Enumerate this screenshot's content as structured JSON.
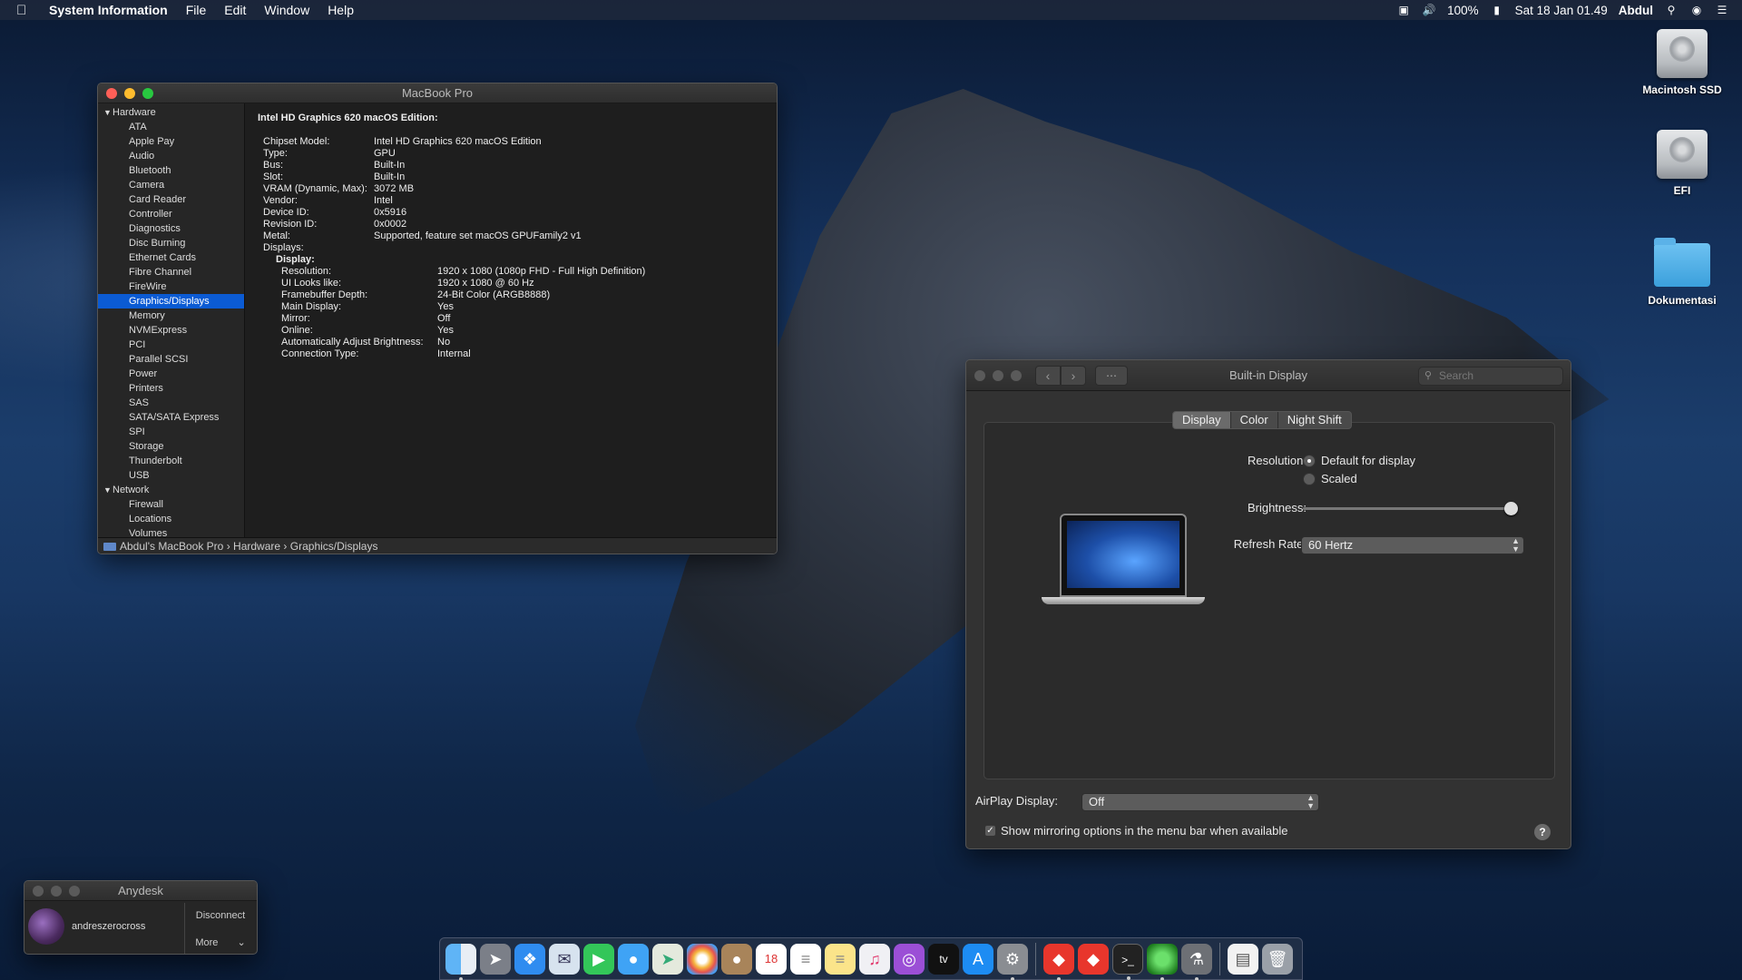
{
  "menubar": {
    "app": "System Information",
    "menus": [
      "File",
      "Edit",
      "Window",
      "Help"
    ],
    "battery": "100%",
    "datetime": "Sat 18 Jan  01.49",
    "user": "Abdul"
  },
  "desktop": {
    "icons": [
      "Macintosh SSD",
      "EFI",
      "Dokumentasi"
    ]
  },
  "sysinfo": {
    "title": "MacBook Pro",
    "sidebar": {
      "hardware_label": "Hardware",
      "hardware_items": [
        "ATA",
        "Apple Pay",
        "Audio",
        "Bluetooth",
        "Camera",
        "Card Reader",
        "Controller",
        "Diagnostics",
        "Disc Burning",
        "Ethernet Cards",
        "Fibre Channel",
        "FireWire",
        "Graphics/Displays",
        "Memory",
        "NVMExpress",
        "PCI",
        "Parallel SCSI",
        "Power",
        "Printers",
        "SAS",
        "SATA/SATA Express",
        "SPI",
        "Storage",
        "Thunderbolt",
        "USB"
      ],
      "selected": "Graphics/Displays",
      "network_label": "Network",
      "network_items": [
        "Firewall",
        "Locations",
        "Volumes"
      ]
    },
    "main": {
      "heading": "Intel HD Graphics 620 macOS Edition:",
      "rows": [
        {
          "k": "Chipset Model:",
          "v": "Intel HD Graphics 620 macOS Edition"
        },
        {
          "k": "Type:",
          "v": "GPU"
        },
        {
          "k": "Bus:",
          "v": "Built-In"
        },
        {
          "k": "Slot:",
          "v": "Built-In"
        },
        {
          "k": "VRAM (Dynamic, Max):",
          "v": "3072 MB"
        },
        {
          "k": "Vendor:",
          "v": "Intel"
        },
        {
          "k": "Device ID:",
          "v": "0x5916"
        },
        {
          "k": "Revision ID:",
          "v": "0x0002"
        },
        {
          "k": "Metal:",
          "v": "Supported, feature set macOS GPUFamily2 v1"
        },
        {
          "k": "Displays:",
          "v": ""
        }
      ],
      "display_label": "Display:",
      "display_rows": [
        {
          "k": "Resolution:",
          "v": "1920 x 1080 (1080p FHD - Full High Definition)"
        },
        {
          "k": "UI Looks like:",
          "v": "1920 x 1080 @ 60 Hz"
        },
        {
          "k": "Framebuffer Depth:",
          "v": "24-Bit Color (ARGB8888)"
        },
        {
          "k": "Main Display:",
          "v": "Yes"
        },
        {
          "k": "Mirror:",
          "v": "Off"
        },
        {
          "k": "Online:",
          "v": "Yes"
        },
        {
          "k": "Automatically Adjust Brightness:",
          "v": "No"
        },
        {
          "k": "Connection Type:",
          "v": "Internal"
        }
      ]
    },
    "path": [
      "Abdul's MacBook Pro",
      "Hardware",
      "Graphics/Displays"
    ]
  },
  "display_prefs": {
    "title": "Built-in Display",
    "search_placeholder": "Search",
    "tabs": [
      "Display",
      "Color",
      "Night Shift"
    ],
    "active_tab": "Display",
    "resolution_label": "Resolution:",
    "resolution_options": [
      "Default for display",
      "Scaled"
    ],
    "resolution_selected": "Default for display",
    "brightness_label": "Brightness:",
    "brightness_level": 0.98,
    "refresh_label": "Refresh Rate:",
    "refresh_value": "60 Hertz",
    "airplay_label": "AirPlay Display:",
    "airplay_value": "Off",
    "mirroring_label": "Show mirroring options in the menu bar when available",
    "mirroring_checked": true
  },
  "anydesk": {
    "title": "Anydesk",
    "user": "andreszerocross",
    "disconnect": "Disconnect",
    "more": "More"
  }
}
